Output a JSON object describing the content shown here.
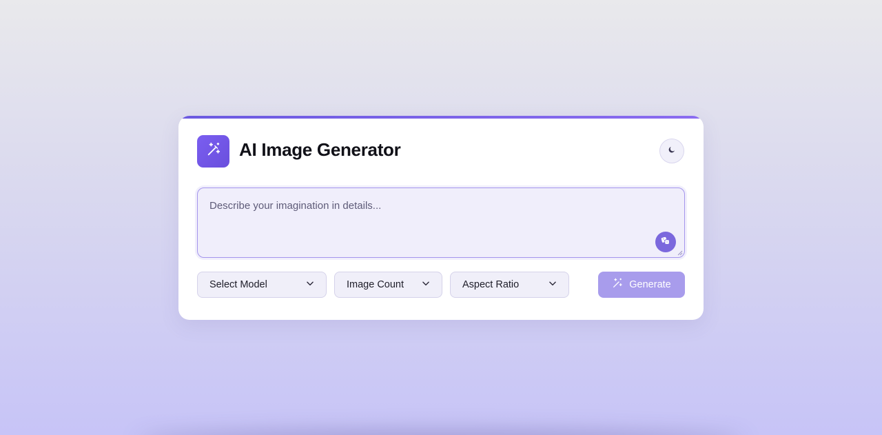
{
  "app": {
    "title": "AI Image Generator"
  },
  "prompt": {
    "placeholder": "Describe your imagination in details...",
    "value": ""
  },
  "controls": {
    "model_label": "Select Model",
    "count_label": "Image Count",
    "ratio_label": "Aspect Ratio",
    "generate_label": "Generate"
  },
  "icons": {
    "logo": "magic-wand-icon",
    "theme": "moon-icon",
    "random": "dice-icon",
    "dropdown": "chevron-down-icon",
    "generate": "magic-wand-icon"
  },
  "colors": {
    "accent": "#6b5ae0",
    "generate_button": "#a89cec",
    "prompt_bg": "#f0eefb"
  }
}
